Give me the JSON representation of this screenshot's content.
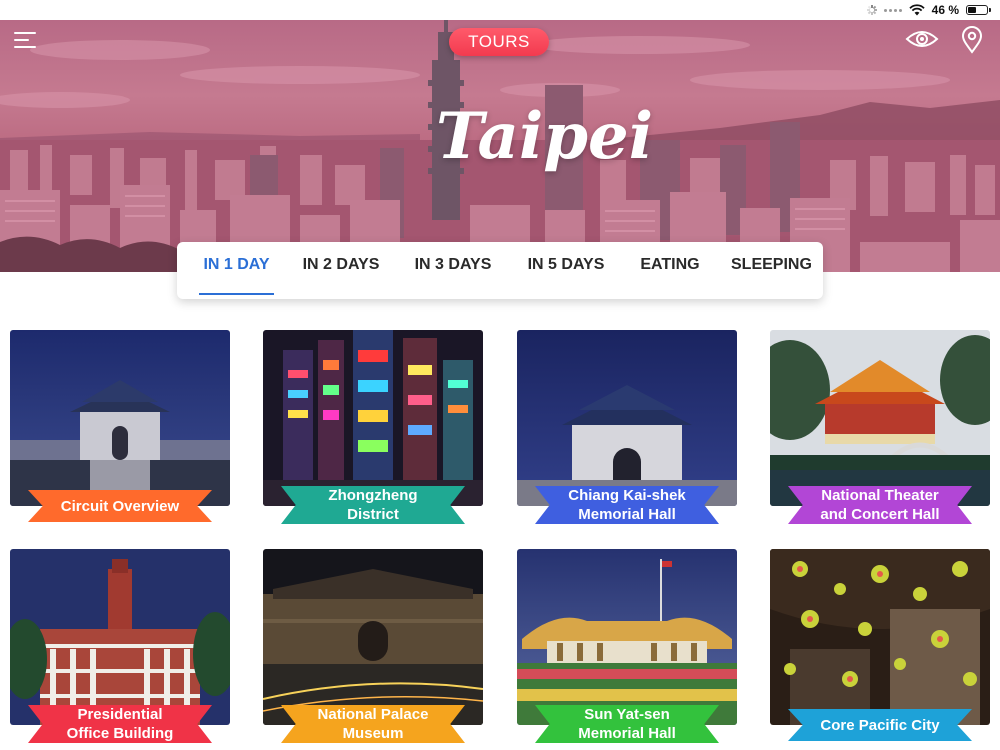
{
  "status_bar": {
    "battery_percent": "46 %",
    "battery_level": 0.46
  },
  "header": {
    "tours_label": "TOURS",
    "city_title": "Taipei"
  },
  "icons": {
    "menu": "menu-icon",
    "eye": "eye-icon",
    "location": "location-pin-icon",
    "wifi": "wifi-icon",
    "battery": "battery-icon"
  },
  "tabs": [
    {
      "label": "IN 1 DAY",
      "active": true
    },
    {
      "label": "IN 2 DAYS",
      "active": false
    },
    {
      "label": "IN 3 DAYS",
      "active": false
    },
    {
      "label": "IN 5 DAYS",
      "active": false
    },
    {
      "label": "EATING",
      "active": false
    },
    {
      "label": "SLEEPING",
      "active": false
    }
  ],
  "colors": {
    "active_tab": "#2b6fd6",
    "tours_button": "#f23a4f"
  },
  "cards": [
    {
      "line1": "Circuit Overview",
      "line2": "",
      "ribbon_color": "#ff6a2c"
    },
    {
      "line1": "Zhongzheng",
      "line2": "District",
      "ribbon_color": "#1fa993"
    },
    {
      "line1": "Chiang Kai-shek",
      "line2": "Memorial Hall",
      "ribbon_color": "#3f5fe0"
    },
    {
      "line1": "National Theater",
      "line2": "and Concert Hall",
      "ribbon_color": "#b246d6"
    },
    {
      "line1": "Presidential",
      "line2": "Office Building",
      "ribbon_color": "#f03347"
    },
    {
      "line1": "National Palace",
      "line2": "Museum",
      "ribbon_color": "#f5a41e"
    },
    {
      "line1": "Sun Yat-sen",
      "line2": "Memorial Hall",
      "ribbon_color": "#33c23d"
    },
    {
      "line1": "Core Pacific City",
      "line2": "",
      "ribbon_color": "#1ea2d8"
    }
  ]
}
